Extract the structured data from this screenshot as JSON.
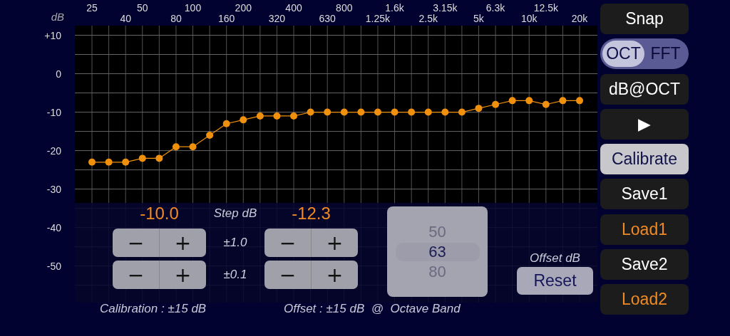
{
  "chart": {
    "chart_data": {
      "type": "line",
      "ylabel": "dB",
      "categories": [
        "25",
        null,
        "40",
        "50",
        null,
        "80",
        "100",
        null,
        "160",
        "200",
        null,
        "320",
        "400",
        null,
        "630",
        "800",
        null,
        "1.25k",
        "1.6k",
        null,
        "2.5k",
        "3.15k",
        null,
        "5k",
        "6.3k",
        null,
        "10k",
        "12.5k",
        null,
        "20k"
      ],
      "grid": true,
      "series": [
        {
          "color": "#f0900c",
          "marker": "o",
          "values": [
            -23,
            -23,
            -23,
            -22,
            -22,
            -19,
            -19,
            -16,
            -13,
            -12,
            -11,
            -11,
            -11,
            -10,
            -10,
            -10,
            -10,
            -10,
            -10,
            -10,
            -10,
            -10,
            -10,
            -9,
            -8,
            -7,
            -7,
            -8,
            -7,
            -7
          ]
        }
      ],
      "ylim": [
        -59.5,
        12.5
      ],
      "yticks": [
        {
          "value": 10,
          "label": "+10"
        },
        0,
        -10,
        -20,
        -30,
        -40,
        -50
      ]
    }
  },
  "calibration": {
    "value": "-10.0",
    "caption": "Calibration : ±15 dB"
  },
  "step": {
    "label": "Step dB",
    "rows": [
      {
        "step": "±1.0",
        "calibration": {
          "minus": "−",
          "plus": "+"
        },
        "offset": {
          "minus": "−",
          "plus": "+"
        }
      },
      {
        "step": "±0.1",
        "calibration": {
          "minus": "−",
          "plus": "+"
        },
        "offset": {
          "minus": "−",
          "plus": "+"
        }
      }
    ]
  },
  "offset": {
    "value": "-12.3",
    "caption": "Offset : ±15 dB  @  Octave Band",
    "label": "Offset dB",
    "reset": "Reset"
  },
  "band_picker": {
    "items": [
      {
        "label": "50",
        "selected": false
      },
      {
        "label": "63",
        "selected": true
      },
      {
        "label": "80",
        "selected": false
      }
    ]
  },
  "sidebar": {
    "items": [
      {
        "kind": "button",
        "label": "Snap",
        "color": "#ffffff",
        "selected": false
      },
      {
        "kind": "toggle",
        "options": [
          {
            "label": "OCT",
            "selected": true
          },
          {
            "label": "FFT",
            "selected": false
          }
        ]
      },
      {
        "kind": "button",
        "label": "dB@OCT",
        "color": "#ffffff",
        "selected": false
      },
      {
        "kind": "button",
        "label": "▶",
        "color": "#ffffff",
        "selected": false
      },
      {
        "kind": "button",
        "label": "Calibrate",
        "color": "#10104a",
        "selected": true
      },
      {
        "kind": "button",
        "label": "Save1",
        "color": "#ffffff",
        "selected": false
      },
      {
        "kind": "button",
        "label": "Load1",
        "color": "#f08a24",
        "selected": false
      },
      {
        "kind": "button",
        "label": "Save2",
        "color": "#ffffff",
        "selected": false
      },
      {
        "kind": "button",
        "label": "Load2",
        "color": "#f08a24",
        "selected": false
      }
    ]
  }
}
